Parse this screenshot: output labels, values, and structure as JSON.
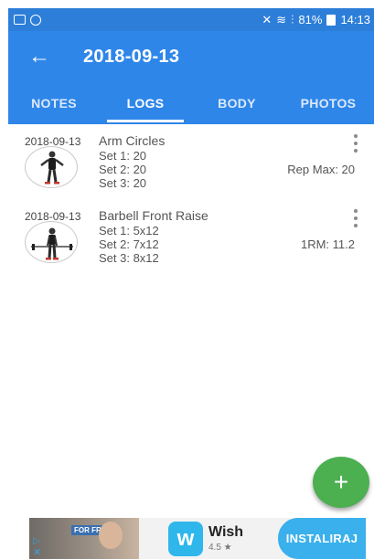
{
  "status_bar": {
    "battery": "81%",
    "time": "14:13"
  },
  "app_bar": {
    "title": "2018-09-13"
  },
  "tabs": [
    {
      "label": "NOTES",
      "active": false
    },
    {
      "label": "LOGS",
      "active": true
    },
    {
      "label": "BODY",
      "active": false
    },
    {
      "label": "PHOTOS",
      "active": false
    }
  ],
  "logs": [
    {
      "date": "2018-09-13",
      "exercise": "Arm Circles",
      "sets": [
        "Set 1: 20",
        "Set 2: 20",
        "Set 3: 20"
      ],
      "metric": "Rep Max: 20"
    },
    {
      "date": "2018-09-13",
      "exercise": "Barbell Front Raise",
      "sets": [
        "Set 1: 5x12",
        "Set 2: 7x12",
        "Set 3: 8x12"
      ],
      "metric": "1RM: 11.2"
    }
  ],
  "fab": {
    "label": "+"
  },
  "ad": {
    "image_tag": "FOR FREE",
    "app_name": "Wish",
    "rating": "4.5 ★",
    "cta": "INSTALIRAJ",
    "logo_letter": "w"
  },
  "colors": {
    "primary": "#2e86e9",
    "status_bar": "#2d7ed8",
    "fab": "#4caf50",
    "install": "#3ab0ec"
  }
}
